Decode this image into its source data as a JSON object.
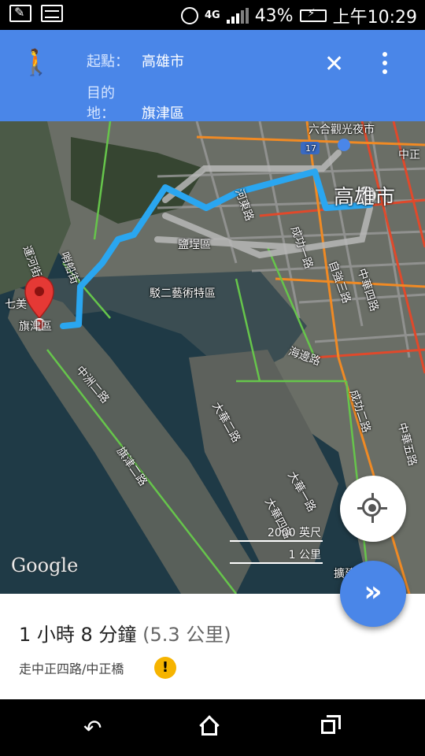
{
  "status_bar": {
    "network": "4G",
    "battery": "43%",
    "time": "上午10:29"
  },
  "header": {
    "origin_label": "起點：",
    "origin_value": "高雄市",
    "destination_label": "目的地：",
    "destination_value": "旗津區"
  },
  "map": {
    "labels": {
      "liuhe": "六合觀光夜市",
      "zhongzheng": "中正",
      "kaohsiung": "高雄市",
      "hedong": "河東路",
      "yancheng": "鹽埕區",
      "pier2": "駁二藝術特區",
      "chenggong1": "成功一路",
      "zizhong": "自強三路",
      "zhonghua4": "中華四路",
      "haibian": "海邊路",
      "yunxiao": "運河街",
      "shipin": "哨船街",
      "qijin": "旗津區",
      "qimei": "七美",
      "zhouzhong": "中洲二路",
      "qijinroad": "旗津二路",
      "dahua2": "大華二路",
      "dahua1": "大華一路",
      "dahua4": "大華四路",
      "chenggong2": "成功二路",
      "zhonghua5": "中華五路",
      "kuojian": "擴建",
      "route17": "17"
    },
    "scale_imperial": "2000 英尺",
    "scale_metric": "1 公里",
    "attribution": "Google"
  },
  "summary": {
    "duration": "1 小時 8 分鐘",
    "distance": "(5.3 公里)",
    "via": "走中正四路/中正橋",
    "warning": "!"
  },
  "icons": {
    "walk": "walk-icon",
    "close": "close-icon",
    "more": "more-vert-icon",
    "locate": "my-location-icon",
    "navigate": "navigate-icon"
  },
  "colors": {
    "header": "#4a86e8",
    "route": "#2aa6f0",
    "pin": "#e53935",
    "warning": "#f6b400"
  }
}
